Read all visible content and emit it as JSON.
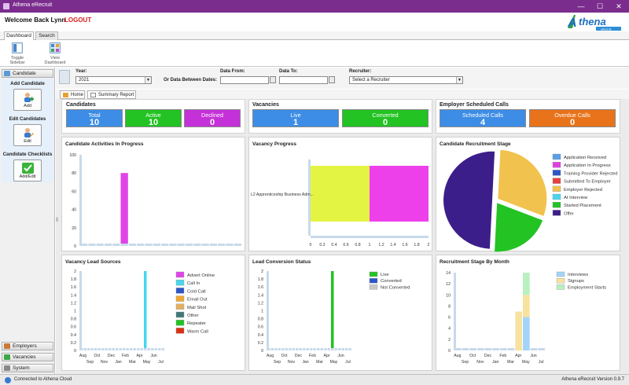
{
  "window": {
    "title": "Athena eRecruit",
    "minimize": "—",
    "maximize": "☐",
    "close": "✕"
  },
  "header": {
    "welcome": "Welcome Back Lynn",
    "logout": "LOGOUT",
    "logo_text": "thena",
    "logo_initial": "A",
    "logo_sub": "eRecruit"
  },
  "ribbon_tabs": [
    "Dashboard",
    "Search"
  ],
  "ribbon_buttons": [
    {
      "label": "Toggle Sidebar",
      "icon": "sidebar-icon"
    },
    {
      "label": "View Dashboard",
      "icon": "dashboard-icon"
    }
  ],
  "sidebar": {
    "candidate_header": "Candidate",
    "sections": [
      {
        "title": "Add Candidate",
        "button": "Add",
        "icon": "add-person-icon"
      },
      {
        "title": "Edit Candidates",
        "button": "Edit",
        "icon": "edit-person-icon"
      },
      {
        "title": "Candidate Checklists",
        "button": "Add/Edit",
        "icon": "checklist-icon"
      }
    ],
    "bottom": [
      "Employers",
      "Vacancies",
      "System"
    ]
  },
  "filters": {
    "year_label": "Year:",
    "year_value": "2021",
    "between_label": "Or Data Between Dates:",
    "from_label": "Data From:",
    "from_value": "",
    "to_label": "Data To:",
    "to_value": "",
    "recruiter_label": "Recruiter:",
    "recruiter_value": "Select a Recruiter"
  },
  "page_tabs": [
    "Home",
    "Summary Report"
  ],
  "kpis": {
    "candidates": {
      "title": "Candidates",
      "tiles": [
        {
          "label": "Total",
          "value": "10",
          "color": "#3d8de6"
        },
        {
          "label": "Active",
          "value": "10",
          "color": "#22c322"
        },
        {
          "label": "Declined",
          "value": "0",
          "color": "#c531d8"
        }
      ]
    },
    "vacancies": {
      "title": "Vacancies",
      "tiles": [
        {
          "label": "Live",
          "value": "1",
          "color": "#3d8de6"
        },
        {
          "label": "Converted",
          "value": "0",
          "color": "#22c322"
        }
      ]
    },
    "calls": {
      "title": "Employer Scheduled Calls",
      "tiles": [
        {
          "label": "Scheduled Calls",
          "value": "4",
          "color": "#3d8de6"
        },
        {
          "label": "Overdue Calls",
          "value": "0",
          "color": "#e8731a"
        }
      ]
    }
  },
  "panels": {
    "activities": "Candidate Activities In Progress",
    "vacancy_progress": "Vacancy Progress",
    "recruitment_stage": "Candidate Recruitment Stage",
    "lead_sources": "Vacancy Lead Sources",
    "lead_conversion": "Lead Conversion Status",
    "stage_by_month": "Recruitment Stage By Month"
  },
  "chart_data": [
    {
      "type": "bar",
      "title": "Candidate Activities In Progress",
      "ylim": [
        0,
        100
      ],
      "yticks": [
        "0",
        "20",
        "40",
        "60",
        "80",
        "100"
      ],
      "bars": [
        {
          "value": 80,
          "color": "#e043e8",
          "slot": 5
        }
      ],
      "slots": 20
    },
    {
      "type": "bar",
      "title": "Vacancy Progress",
      "orientation": "horizontal",
      "category": "L2 Apprenticeship Business Adm...",
      "xticks": [
        "0",
        "0.2",
        "0.4",
        "0.6",
        "0.8",
        "1",
        "1.2",
        "1.4",
        "1.6",
        "1.8",
        "2"
      ],
      "xlim": [
        0,
        2
      ],
      "series": [
        {
          "value": 1,
          "color": "#e4f442"
        },
        {
          "value": 1,
          "color": "#ee40ea"
        }
      ]
    },
    {
      "type": "pie",
      "title": "Candidate Recruitment Stage",
      "legend": [
        {
          "label": "Application Received",
          "color": "#58a0e8",
          "value": 0
        },
        {
          "label": "Application In Progress",
          "color": "#e040e0",
          "value": 0
        },
        {
          "label": "Training Provider Rejected",
          "color": "#2c56c8",
          "value": 0
        },
        {
          "label": "Submitted To Employer",
          "color": "#e84040",
          "value": 0
        },
        {
          "label": "Employer Rejected",
          "color": "#f2c24e",
          "value": 3
        },
        {
          "label": "At Interview",
          "color": "#46d6ee",
          "value": 0
        },
        {
          "label": "Started Placement",
          "color": "#22c322",
          "value": 2
        },
        {
          "label": "Offer",
          "color": "#3c1e8a",
          "value": 5
        }
      ]
    },
    {
      "type": "bar",
      "title": "Vacancy Lead Sources",
      "ylim": [
        0,
        2
      ],
      "yticks": [
        "0",
        "0.2",
        "0.4",
        "0.6",
        "0.8",
        "1",
        "1.2",
        "1.4",
        "1.6",
        "1.8",
        "2"
      ],
      "xticks_top": [
        "Aug",
        "Oct",
        "Dec",
        "Feb",
        "Apr",
        "Jun"
      ],
      "xticks_bottom": [
        "Sep",
        "Nov",
        "Jan",
        "Mar",
        "May",
        "Jul"
      ],
      "bars": [
        {
          "value": 2,
          "color": "#46d6ee",
          "slot": 18
        }
      ],
      "slots": 24,
      "legend": [
        {
          "label": "Advert Online",
          "color": "#e043e8"
        },
        {
          "label": "Call In",
          "color": "#46d6ee"
        },
        {
          "label": "Cold Call",
          "color": "#2c56c8"
        },
        {
          "label": "Email Out",
          "color": "#f0a830"
        },
        {
          "label": "Mail Shot",
          "color": "#e4b060"
        },
        {
          "label": "Other",
          "color": "#407878"
        },
        {
          "label": "Repeater",
          "color": "#22c322"
        },
        {
          "label": "Warm Call",
          "color": "#d83010"
        }
      ]
    },
    {
      "type": "bar",
      "title": "Lead Conversion Status",
      "ylim": [
        0,
        2
      ],
      "yticks": [
        "0",
        "0.2",
        "0.4",
        "0.6",
        "0.8",
        "1",
        "1.2",
        "1.4",
        "1.6",
        "1.8",
        "2"
      ],
      "xticks_top": [
        "Aug",
        "Oct",
        "Dec",
        "Feb",
        "Apr",
        "Jun"
      ],
      "xticks_bottom": [
        "Sep",
        "Nov",
        "Jan",
        "Mar",
        "May",
        "Jul"
      ],
      "bars": [
        {
          "value": 2,
          "color": "#22c322",
          "slot": 18
        }
      ],
      "slots": 24,
      "legend": [
        {
          "label": "Live",
          "color": "#22c322"
        },
        {
          "label": "Converted",
          "color": "#2c56c8"
        },
        {
          "label": "Not Converted",
          "color": "#c8c8c8"
        }
      ]
    },
    {
      "type": "bar",
      "title": "Recruitment Stage By Month",
      "ylim": [
        0,
        14
      ],
      "yticks": [
        "0",
        "2",
        "4",
        "6",
        "8",
        "10",
        "12",
        "14"
      ],
      "xticks_top": [
        "Aug",
        "Oct",
        "Dec",
        "Feb",
        "Apr",
        "Jun"
      ],
      "xticks_bottom": [
        "Sep",
        "Nov",
        "Jan",
        "Mar",
        "May",
        "Jul"
      ],
      "slots": 12,
      "stacks": [
        {
          "slot": 8,
          "segments": [
            {
              "value": 7,
              "color": "#f8e2a0"
            }
          ]
        },
        {
          "slot": 9,
          "segments": [
            {
              "value": 6,
              "color": "#a4d4f8"
            },
            {
              "value": 4,
              "color": "#f8e2a0"
            },
            {
              "value": 4,
              "color": "#b8f0c0"
            }
          ]
        }
      ],
      "legend": [
        {
          "label": "Interviews",
          "color": "#a4d4f8"
        },
        {
          "label": "Signups",
          "color": "#f8e2a0"
        },
        {
          "label": "Employment Starts",
          "color": "#b8f0c0"
        }
      ]
    }
  ],
  "statusbar": {
    "left": "Connected to Athena Cloud",
    "right": "Athena eRecruit Version 0.9.7"
  }
}
